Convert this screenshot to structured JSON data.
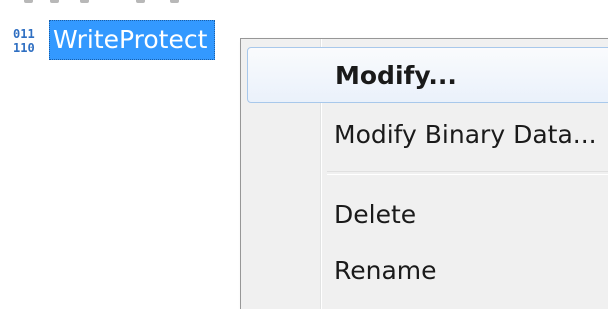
{
  "tree": {
    "selected_value": {
      "name": "WriteProtect",
      "icon": "registry-binary-value-icon"
    }
  },
  "context_menu": {
    "items": [
      {
        "label": "Modify...",
        "default": true,
        "highlighted": true
      },
      {
        "label": "Modify Binary Data...",
        "default": false,
        "highlighted": false
      },
      {
        "label": "Delete",
        "default": false,
        "highlighted": false
      },
      {
        "label": "Rename",
        "default": false,
        "highlighted": false
      }
    ]
  },
  "colors": {
    "selection": "#3399ff",
    "menu_background": "#f0f0f0",
    "hover_border": "#a8c8eb"
  }
}
